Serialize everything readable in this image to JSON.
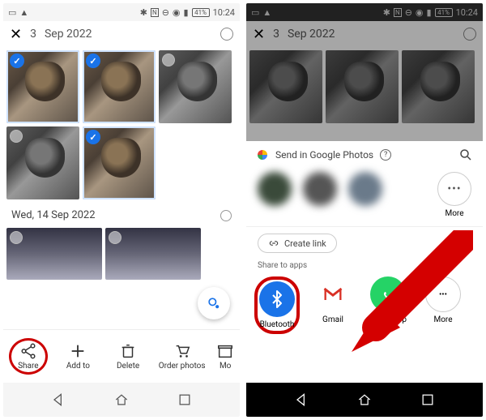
{
  "status": {
    "battery": "41%",
    "time": "10:24"
  },
  "left": {
    "header": {
      "count": "3",
      "date_part": "Sep 2022"
    },
    "section2": "Wed, 14 Sep 2022",
    "actions": {
      "share": "Share",
      "add": "Add to",
      "delete": "Delete",
      "order": "Order photos",
      "more": "Mo"
    }
  },
  "right": {
    "sheet_title": "Send in Google Photos",
    "more": "More",
    "create_link": "Create link",
    "share_apps_label": "Share to apps",
    "apps": {
      "bluetooth": "Bluetooth",
      "gmail": "Gmail",
      "whatsapp": "WhatsApp",
      "more": "More"
    }
  }
}
